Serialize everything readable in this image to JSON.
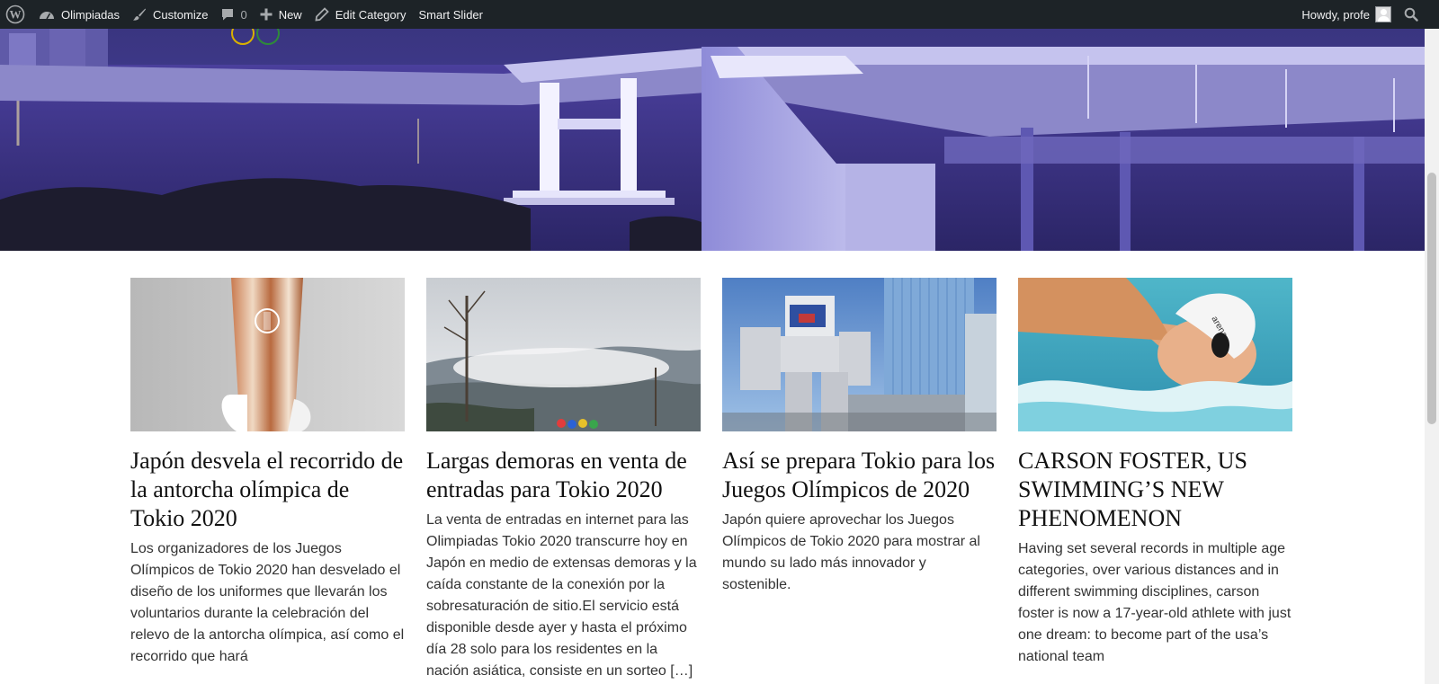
{
  "adminbar": {
    "site_name": "Olimpiadas",
    "customize": "Customize",
    "comments_count": "0",
    "new_label": "New",
    "edit_category": "Edit Category",
    "smart_slider": "Smart Slider",
    "howdy": "Howdy, profe"
  },
  "colors": {
    "adminbar_bg": "#1d2327",
    "adminbar_text": "#f0f0f1",
    "hero_sky": "#2a2460",
    "hero_water": "#4b45a8"
  },
  "posts": [
    {
      "title": "Japón desvela el recorrido de la antorcha olímpica de Tokio 2020",
      "excerpt": "Los organizadores de los Juegos Olímpicos de Tokio 2020 han desvelado el diseño de los uniformes que llevarán los voluntarios durante la celebración del relevo de la antorcha olímpica, así como el recorrido que hará",
      "image": "olympic-torch-photo"
    },
    {
      "title": "Largas demoras en venta de entradas para Tokio 2020",
      "excerpt": "La venta de entradas en internet para las Olimpiadas Tokio 2020 transcurre hoy en Japón en medio de extensas demoras y la caída constante de la conexión por la sobresaturación de sitio.El servicio está disponible desde ayer y hasta el próximo día 28 solo para los residentes en la nación asiática, consiste en un sorteo […]",
      "image": "misty-mountain-photo"
    },
    {
      "title": "Así se prepara Tokio para los Juegos Olímpicos de 2020",
      "excerpt": "Japón quiere aprovechar los Juegos Olímpicos de Tokio 2020 para mostrar al mundo su lado más innovador y sostenible.",
      "image": "gundam-statue-photo"
    },
    {
      "title": "CARSON FOSTER, US SWIMMING’S NEW PHENOMENON",
      "excerpt": "Having set several records in multiple age categories, over various distances and in different swimming disciplines, carson foster is now a 17-year-old athlete with just one dream: to become part of the usa’s national team",
      "image": "swimmer-photo"
    }
  ]
}
